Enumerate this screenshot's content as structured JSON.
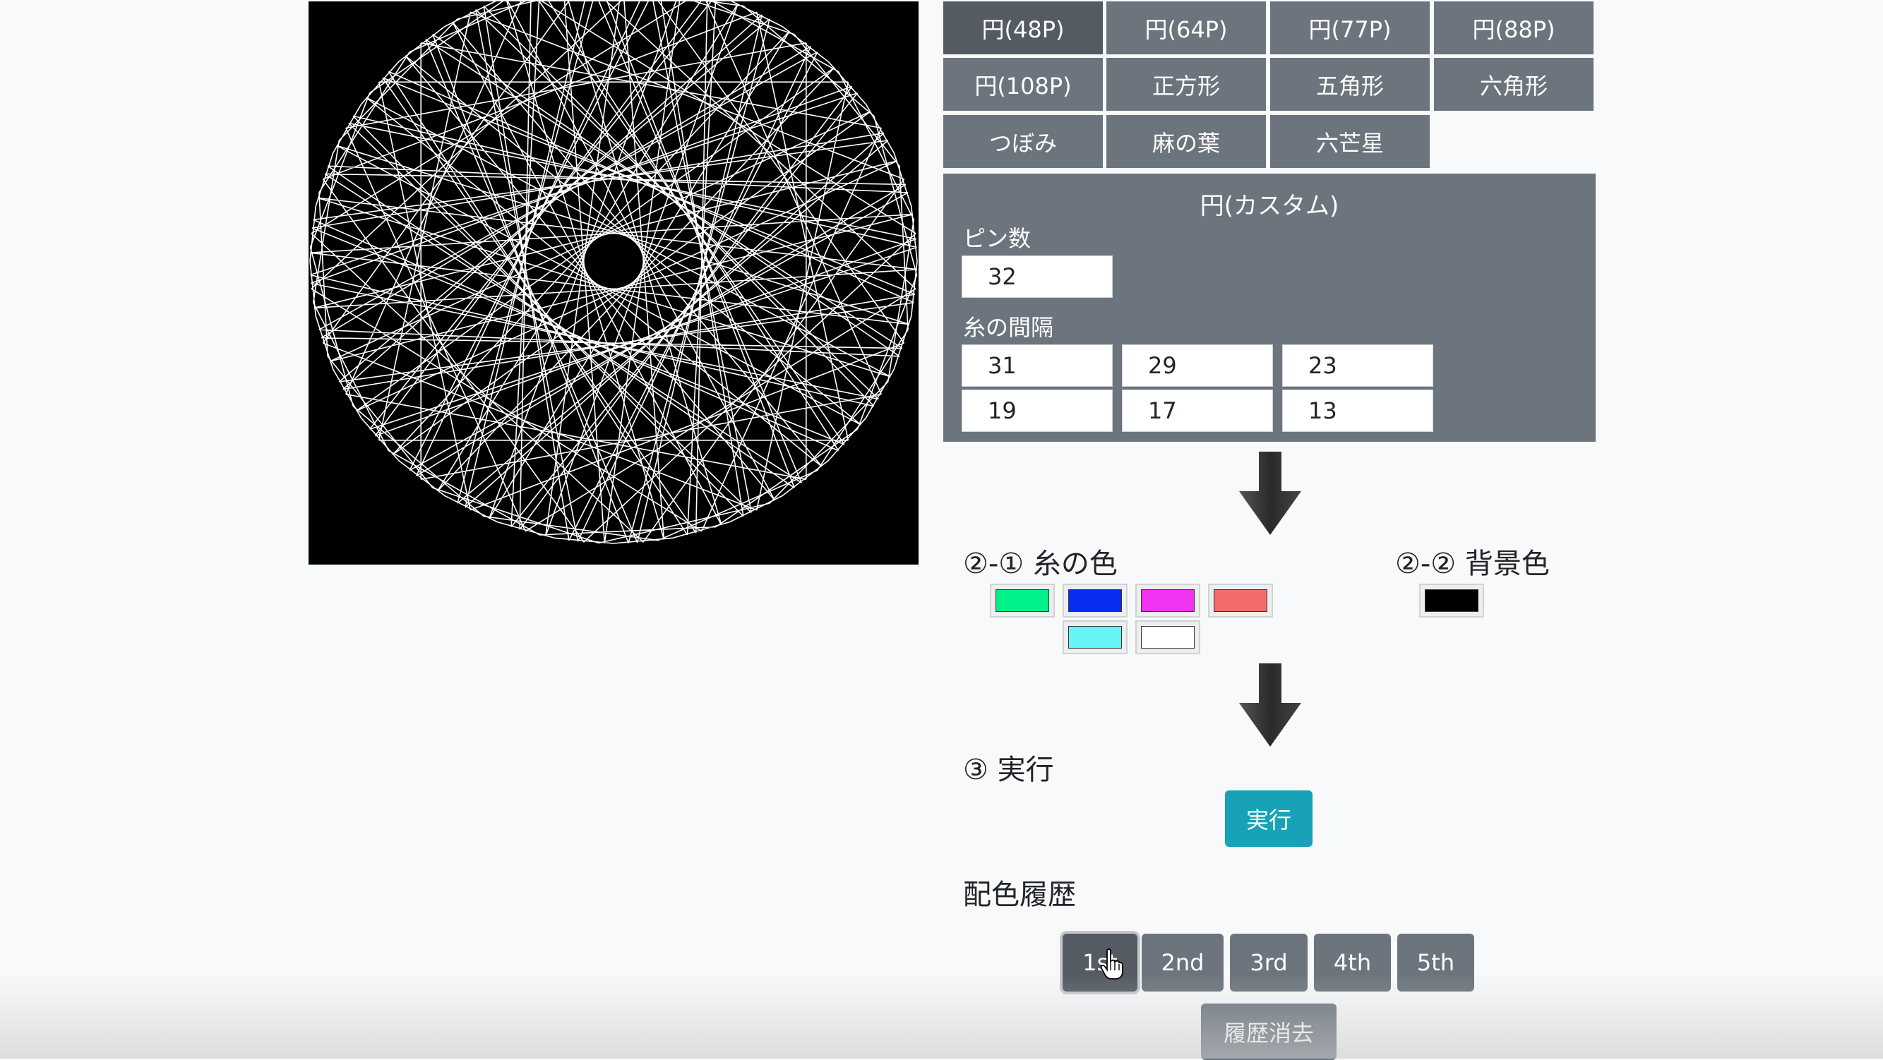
{
  "shape_buttons": [
    "円(48P)",
    "円(64P)",
    "円(77P)",
    "円(88P)",
    "円(108P)",
    "正方形",
    "五角形",
    "六角形",
    "つぼみ",
    "麻の葉",
    "六芒星"
  ],
  "custom": {
    "title": "円(カスタム)",
    "pin_label": "ピン数",
    "pin_count": "32",
    "interval_label": "糸の間隔",
    "intervals": [
      "31",
      "29",
      "23",
      "19",
      "17",
      "13"
    ]
  },
  "thread_color": {
    "label": "②-① 糸の色",
    "colors": [
      "#00f08a",
      "#0a2bf0",
      "#f033f0",
      "#f56b6b",
      "#66f5f5",
      "#ffffff"
    ]
  },
  "bg_color": {
    "label": "②-② 背景色",
    "color": "#000000"
  },
  "execute": {
    "label": "③ 実行",
    "button": "実行"
  },
  "history": {
    "label": "配色履歴",
    "buttons": [
      "1st",
      "2nd",
      "3rd",
      "4th",
      "5th"
    ],
    "active_index": 0,
    "clear_button": "履歴消去"
  },
  "string_art": {
    "background": "#000000",
    "thread_color": "#ffffff",
    "pin_count": 32,
    "intervals": [
      31,
      29,
      23,
      19,
      17,
      13
    ]
  }
}
